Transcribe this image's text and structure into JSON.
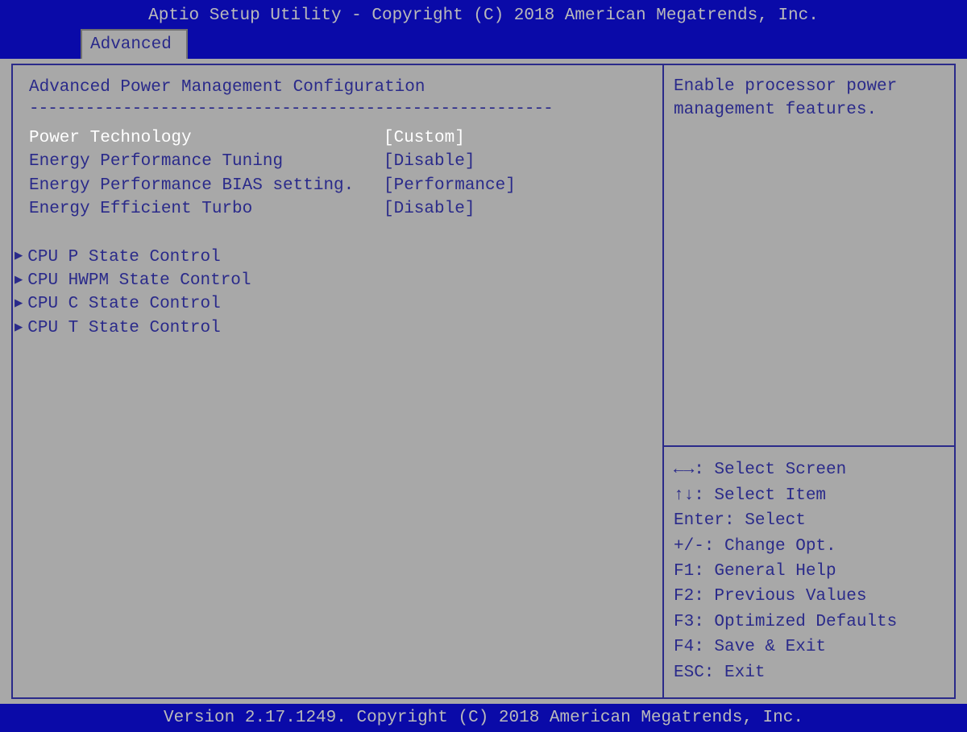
{
  "header": {
    "title": "Aptio Setup Utility - Copyright (C) 2018 American Megatrends, Inc."
  },
  "tab": {
    "label": "Advanced"
  },
  "main": {
    "section_title": "Advanced Power Management Configuration",
    "divider": "--------------------------------------------------------",
    "options": [
      {
        "label": "Power Technology",
        "value": "[Custom]",
        "selected": true
      },
      {
        "label": "Energy Performance Tuning",
        "value": "[Disable]",
        "selected": false
      },
      {
        "label": "Energy Performance BIAS setting.",
        "value": "[Performance]",
        "selected": false
      },
      {
        "label": "Energy Efficient Turbo",
        "value": "[Disable]",
        "selected": false
      }
    ],
    "submenus": [
      {
        "label": "CPU P State Control"
      },
      {
        "label": "CPU HWPM State Control"
      },
      {
        "label": "CPU C State Control"
      },
      {
        "label": "CPU T State Control"
      }
    ]
  },
  "help": {
    "line1": "Enable processor power",
    "line2": "management features."
  },
  "legend": {
    "l1": "←→: Select Screen",
    "l2": "↑↓: Select Item",
    "l3": "Enter: Select",
    "l4": "+/-: Change Opt.",
    "l5": "F1: General Help",
    "l6": "F2: Previous Values",
    "l7": "F3: Optimized Defaults",
    "l8": "F4: Save & Exit",
    "l9": "ESC: Exit"
  },
  "footer": {
    "text": "Version 2.17.1249. Copyright (C) 2018 American Megatrends, Inc."
  }
}
